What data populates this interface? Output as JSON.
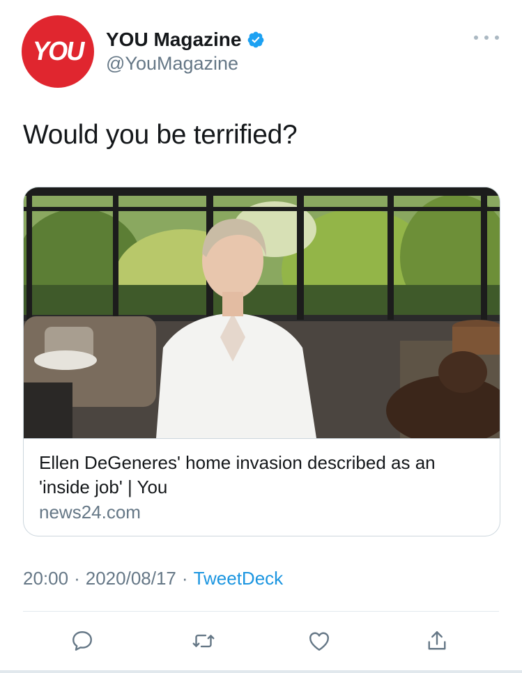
{
  "author": {
    "display_name": "YOU Magazine",
    "handle": "@YouMagazine",
    "avatar_text": "YOU",
    "avatar_color": "#e0262f",
    "verified": true
  },
  "tweet": {
    "text": "Would you be terrified?"
  },
  "card": {
    "title": "Ellen DeGeneres' home invasion described as an 'inside job' | You",
    "domain": "news24.com",
    "image_description_icon": "link-preview-photo"
  },
  "meta": {
    "time": "20:00",
    "separator": "·",
    "date": "2020/08/17",
    "source": "TweetDeck"
  },
  "actions": {
    "reply_icon": "reply-icon",
    "retweet_icon": "retweet-icon",
    "like_icon": "heart-icon",
    "share_icon": "share-icon"
  },
  "colors": {
    "accent": "#1b95e0",
    "secondary_text": "#657786",
    "verified": "#1da1f2",
    "border": "#ccd6dd"
  }
}
